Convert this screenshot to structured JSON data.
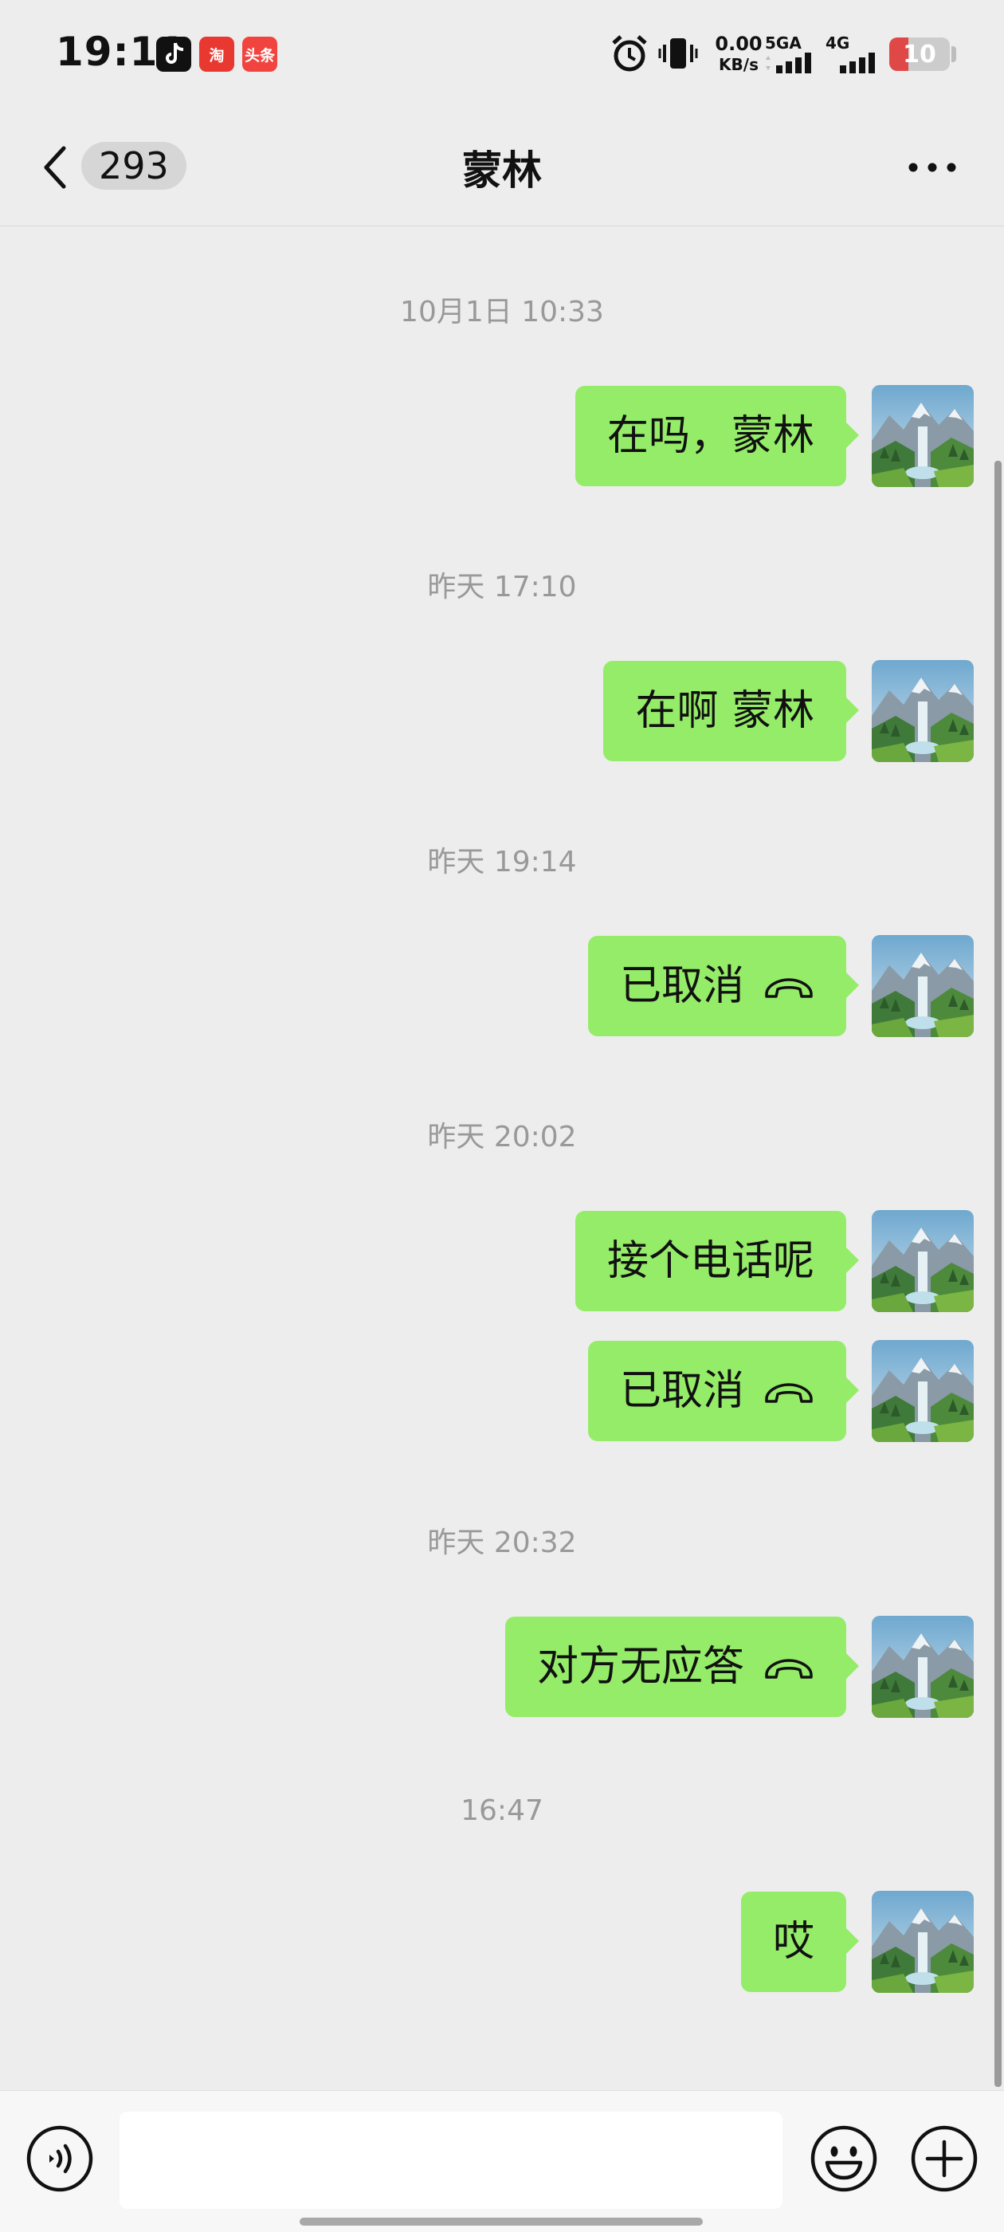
{
  "status_bar": {
    "time": "19:11",
    "app_icons": [
      "tiktok-icon",
      "taobao-icon",
      "toutiao-icon"
    ],
    "taobao_label": "淘",
    "toutiao_label": "头条",
    "net_speed_value": "0.00",
    "net_speed_unit": "KB/s",
    "network_1": "5GA",
    "network_2": "4G",
    "battery_level": "10",
    "battery_fraction": 0.1
  },
  "nav": {
    "back_icon": "chevron-left-icon",
    "unread_count": "293",
    "title": "蒙林",
    "more_icon": "ellipsis-icon"
  },
  "timestamps": [
    "10月1日 10:33",
    "昨天 17:10",
    "昨天 19:14",
    "昨天 20:02",
    "昨天 20:32",
    "16:47"
  ],
  "messages": [
    {
      "text": "在吗，蒙林",
      "sender": "self",
      "call": false
    },
    {
      "text": "在啊 蒙林",
      "sender": "self",
      "call": false
    },
    {
      "text": "已取消",
      "sender": "self",
      "call": true
    },
    {
      "text": "接个电话呢",
      "sender": "self",
      "call": false
    },
    {
      "text": "已取消",
      "sender": "self",
      "call": true
    },
    {
      "text": "对方无应答",
      "sender": "self",
      "call": true
    },
    {
      "text": "哎",
      "sender": "self",
      "call": false
    }
  ],
  "input_bar": {
    "voice_icon": "voice-icon",
    "input_value": "",
    "emoji_icon": "emoji-icon",
    "plus_icon": "plus-icon"
  },
  "colors": {
    "background": "#ededed",
    "bubble_self": "#95ec69",
    "timestamp_text": "#999999",
    "battery_low": "#e04848"
  }
}
